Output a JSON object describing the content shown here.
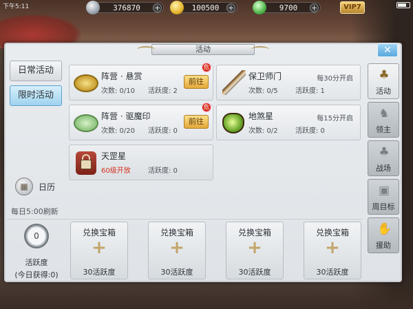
{
  "status_bar": {
    "time": "下午5:11"
  },
  "resources": [
    {
      "icon": "silver-coin-icon",
      "value": "376870"
    },
    {
      "icon": "gold-ingot-icon",
      "value": "100500"
    },
    {
      "icon": "jade-icon",
      "value": "9700"
    }
  ],
  "vip": {
    "label": "VIP7"
  },
  "panel": {
    "title": "活动",
    "close_label": "✕"
  },
  "left_tabs": {
    "daily": "日常活动",
    "limited": "限时活动"
  },
  "calendar": {
    "label": "日历",
    "glyph": "▦",
    "refresh": "每日5:00刷新"
  },
  "activities": {
    "bounty": {
      "name": "阵营 · 悬赏",
      "count": "次数: 0/10",
      "activity": "活跃度: 2",
      "button": "前往",
      "badge": "危"
    },
    "guard": {
      "name": "保卫师门",
      "count": "次数: 0/5",
      "activity": "活跃度: 1",
      "schedule": "每30分开启"
    },
    "seal": {
      "name": "阵营 · 驱魔印",
      "count": "次数: 0/20",
      "activity": "活跃度: 0",
      "button": "前往",
      "badge": "危"
    },
    "earth_star": {
      "name": "地煞星",
      "count": "次数: 0/2",
      "activity": "活跃度: 0",
      "schedule": "每15分开启"
    },
    "heaven_star": {
      "name": "天罡星",
      "requirement": "60级开放",
      "activity": "活跃度: 0"
    }
  },
  "sidebar": [
    {
      "label": "活动",
      "icon": "clover-icon",
      "glyph": "♣"
    },
    {
      "label": "领主",
      "icon": "boss-icon",
      "glyph": "♞"
    },
    {
      "label": "战场",
      "icon": "battlefield-icon",
      "glyph": "♣"
    },
    {
      "label": "周目标",
      "icon": "chest-icon",
      "glyph": "▣"
    },
    {
      "label": "援助",
      "icon": "help-hand-icon",
      "glyph": "✋"
    }
  ],
  "activity_points": {
    "value": "0",
    "label": "活跃度",
    "today": "(今日获得:0)"
  },
  "chests": [
    {
      "title": "兑换宝箱",
      "plus": "+",
      "cost": "30活跃度"
    },
    {
      "title": "兑换宝箱",
      "plus": "+",
      "cost": "30活跃度"
    },
    {
      "title": "兑换宝箱",
      "plus": "+",
      "cost": "30活跃度"
    },
    {
      "title": "兑换宝箱",
      "plus": "+",
      "cost": "30活跃度"
    }
  ],
  "colors": {
    "accent_blue": "#9fd2ef",
    "go_button": "#e3a83a",
    "locked_red": "#d6301e"
  }
}
